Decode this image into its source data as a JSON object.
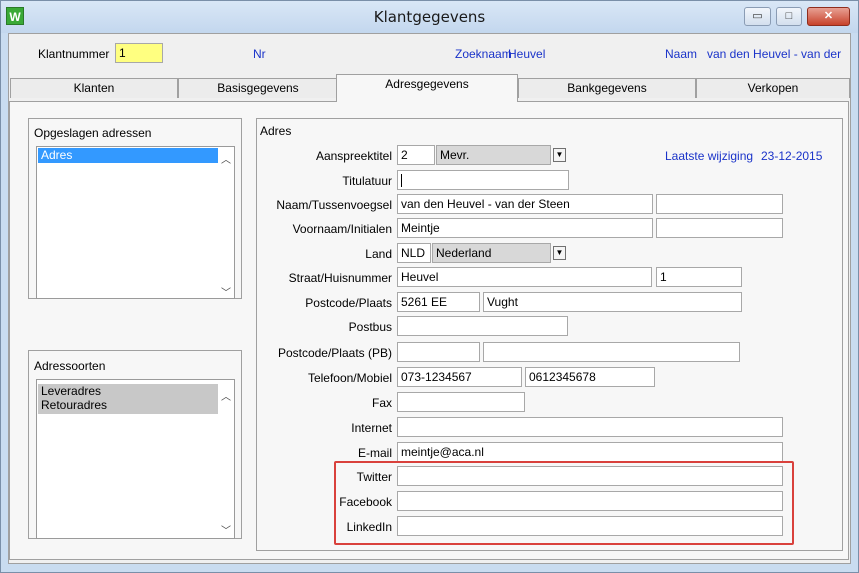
{
  "window": {
    "title": "Klantgegevens",
    "app_icon_letter": "W",
    "minimize": "▭",
    "maximize": "□",
    "close": "✕"
  },
  "header": {
    "klantnummer_label": "Klantnummer",
    "klantnummer_value": "1",
    "nr_label": "Nr",
    "zoeknaam_label": "Zoeknaam",
    "zoeknaam_value": "Heuvel",
    "naam_label": "Naam",
    "naam_value": "van den Heuvel - van der"
  },
  "tabs": [
    {
      "label": "Klanten"
    },
    {
      "label": "Basisgegevens"
    },
    {
      "label": "Adresgegevens"
    },
    {
      "label": "Bankgegevens"
    },
    {
      "label": "Verkopen"
    }
  ],
  "opgeslagen": {
    "title": "Opgeslagen adressen",
    "items": [
      "Adres"
    ]
  },
  "adressoorten": {
    "title": "Adressoorten",
    "items": [
      "Leveradres",
      "Retouradres"
    ]
  },
  "adres": {
    "title": "Adres",
    "laatste_wijziging_label": "Laatste wijziging",
    "laatste_wijziging_value": "23-12-2015",
    "aanspreektitel_label": "Aanspreektitel",
    "aanspreektitel_code": "2",
    "aanspreektitel_value": "Mevr.",
    "titulatuur_label": "Titulatuur",
    "titulatuur_value": "",
    "naam_label": "Naam/Tussenvoegsel",
    "naam_value": "van den Heuvel - van der Steen",
    "tussenvoegsel_value": "",
    "voornaam_label": "Voornaam/Initialen",
    "voornaam_value": "Meintje",
    "initialen_value": "",
    "land_label": "Land",
    "land_code": "NLD",
    "land_value": "Nederland",
    "straat_label": "Straat/Huisnummer",
    "straat_value": "Heuvel",
    "huisnummer_value": "1",
    "postcode_label": "Postcode/Plaats",
    "postcode_value": "5261 EE",
    "plaats_value": "Vught",
    "postbus_label": "Postbus",
    "postbus_value": "",
    "postcode_pb_label": "Postcode/Plaats (PB)",
    "postcode_pb_value": "",
    "plaats_pb_value": "",
    "telefoon_label": "Telefoon/Mobiel",
    "telefoon_value": "073-1234567",
    "mobiel_value": "0612345678",
    "fax_label": "Fax",
    "fax_value": "",
    "internet_label": "Internet",
    "internet_value": "",
    "email_label": "E-mail",
    "email_value": "meintje@aca.nl",
    "twitter_label": "Twitter",
    "twitter_value": "",
    "facebook_label": "Facebook",
    "facebook_value": "",
    "linkedin_label": "LinkedIn",
    "linkedin_value": ""
  },
  "colors": {
    "highlight": "#d9413c",
    "link_blue": "#1a33c9",
    "selected": "#3399ff",
    "yellow_field": "#ffff80"
  }
}
